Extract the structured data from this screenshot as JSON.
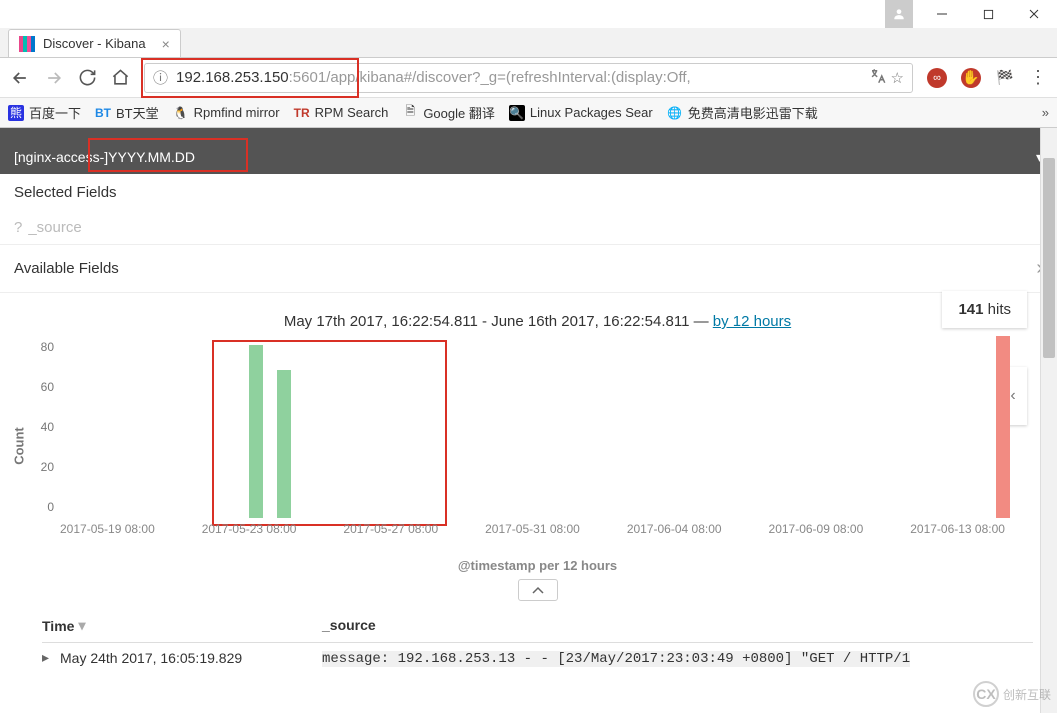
{
  "window": {
    "tab_title": "Discover - Kibana",
    "close_glyph": "×"
  },
  "address": {
    "host": "192.168.253.150",
    "port": ":5601",
    "path": "/app/kibana#/discover?_g=(refreshInterval:(display:Off,"
  },
  "bookmarks": {
    "b1": "百度一下",
    "b2": "BT天堂",
    "b3": "Rpmfind mirror",
    "b4": "RPM Search",
    "b5": "Google 翻译",
    "b6": "Linux Packages Sear",
    "b7": "免费高清电影迅雷下载"
  },
  "sidebar": {
    "index_pattern": "[nginx-access-]YYYY.MM.DD",
    "selected_label": "Selected Fields",
    "source_q": "?",
    "source_field": "_source",
    "available_label": "Available Fields"
  },
  "hits": {
    "count": "141",
    "label": " hits"
  },
  "timerange": {
    "text": "May 17th 2017, 16:22:54.811 - June 16th 2017, 16:22:54.811 — ",
    "link": "by 12 hours"
  },
  "chart_data": {
    "type": "bar",
    "ylabel": "Count",
    "xlabel": "@timestamp per 12 hours",
    "ylim": [
      0,
      80
    ],
    "y_ticks": [
      "80",
      "60",
      "40",
      "20",
      "0"
    ],
    "x_ticks": [
      "2017-05-19 08:00",
      "2017-05-23 08:00",
      "2017-05-27 08:00",
      "2017-05-31 08:00",
      "2017-06-04 08:00",
      "2017-06-09 08:00",
      "2017-06-13 08:00"
    ],
    "bars": [
      {
        "pos_pct": 20,
        "value": 76,
        "color": "green"
      },
      {
        "pos_pct": 23,
        "value": 65,
        "color": "green"
      },
      {
        "pos_pct": 99,
        "value": 80,
        "color": "red"
      }
    ]
  },
  "table": {
    "col_time": "Time",
    "col_source": "_source",
    "rows": [
      {
        "time": "May 24th 2017, 16:05:19.829",
        "msg_label": "message:",
        "msg_body": " 192.168.253.13 - - [23/May/2017:23:03:49 +0800] \"GET / HTTP/1"
      }
    ]
  },
  "watermark": {
    "brand": "创新互联",
    "short": "CX"
  }
}
